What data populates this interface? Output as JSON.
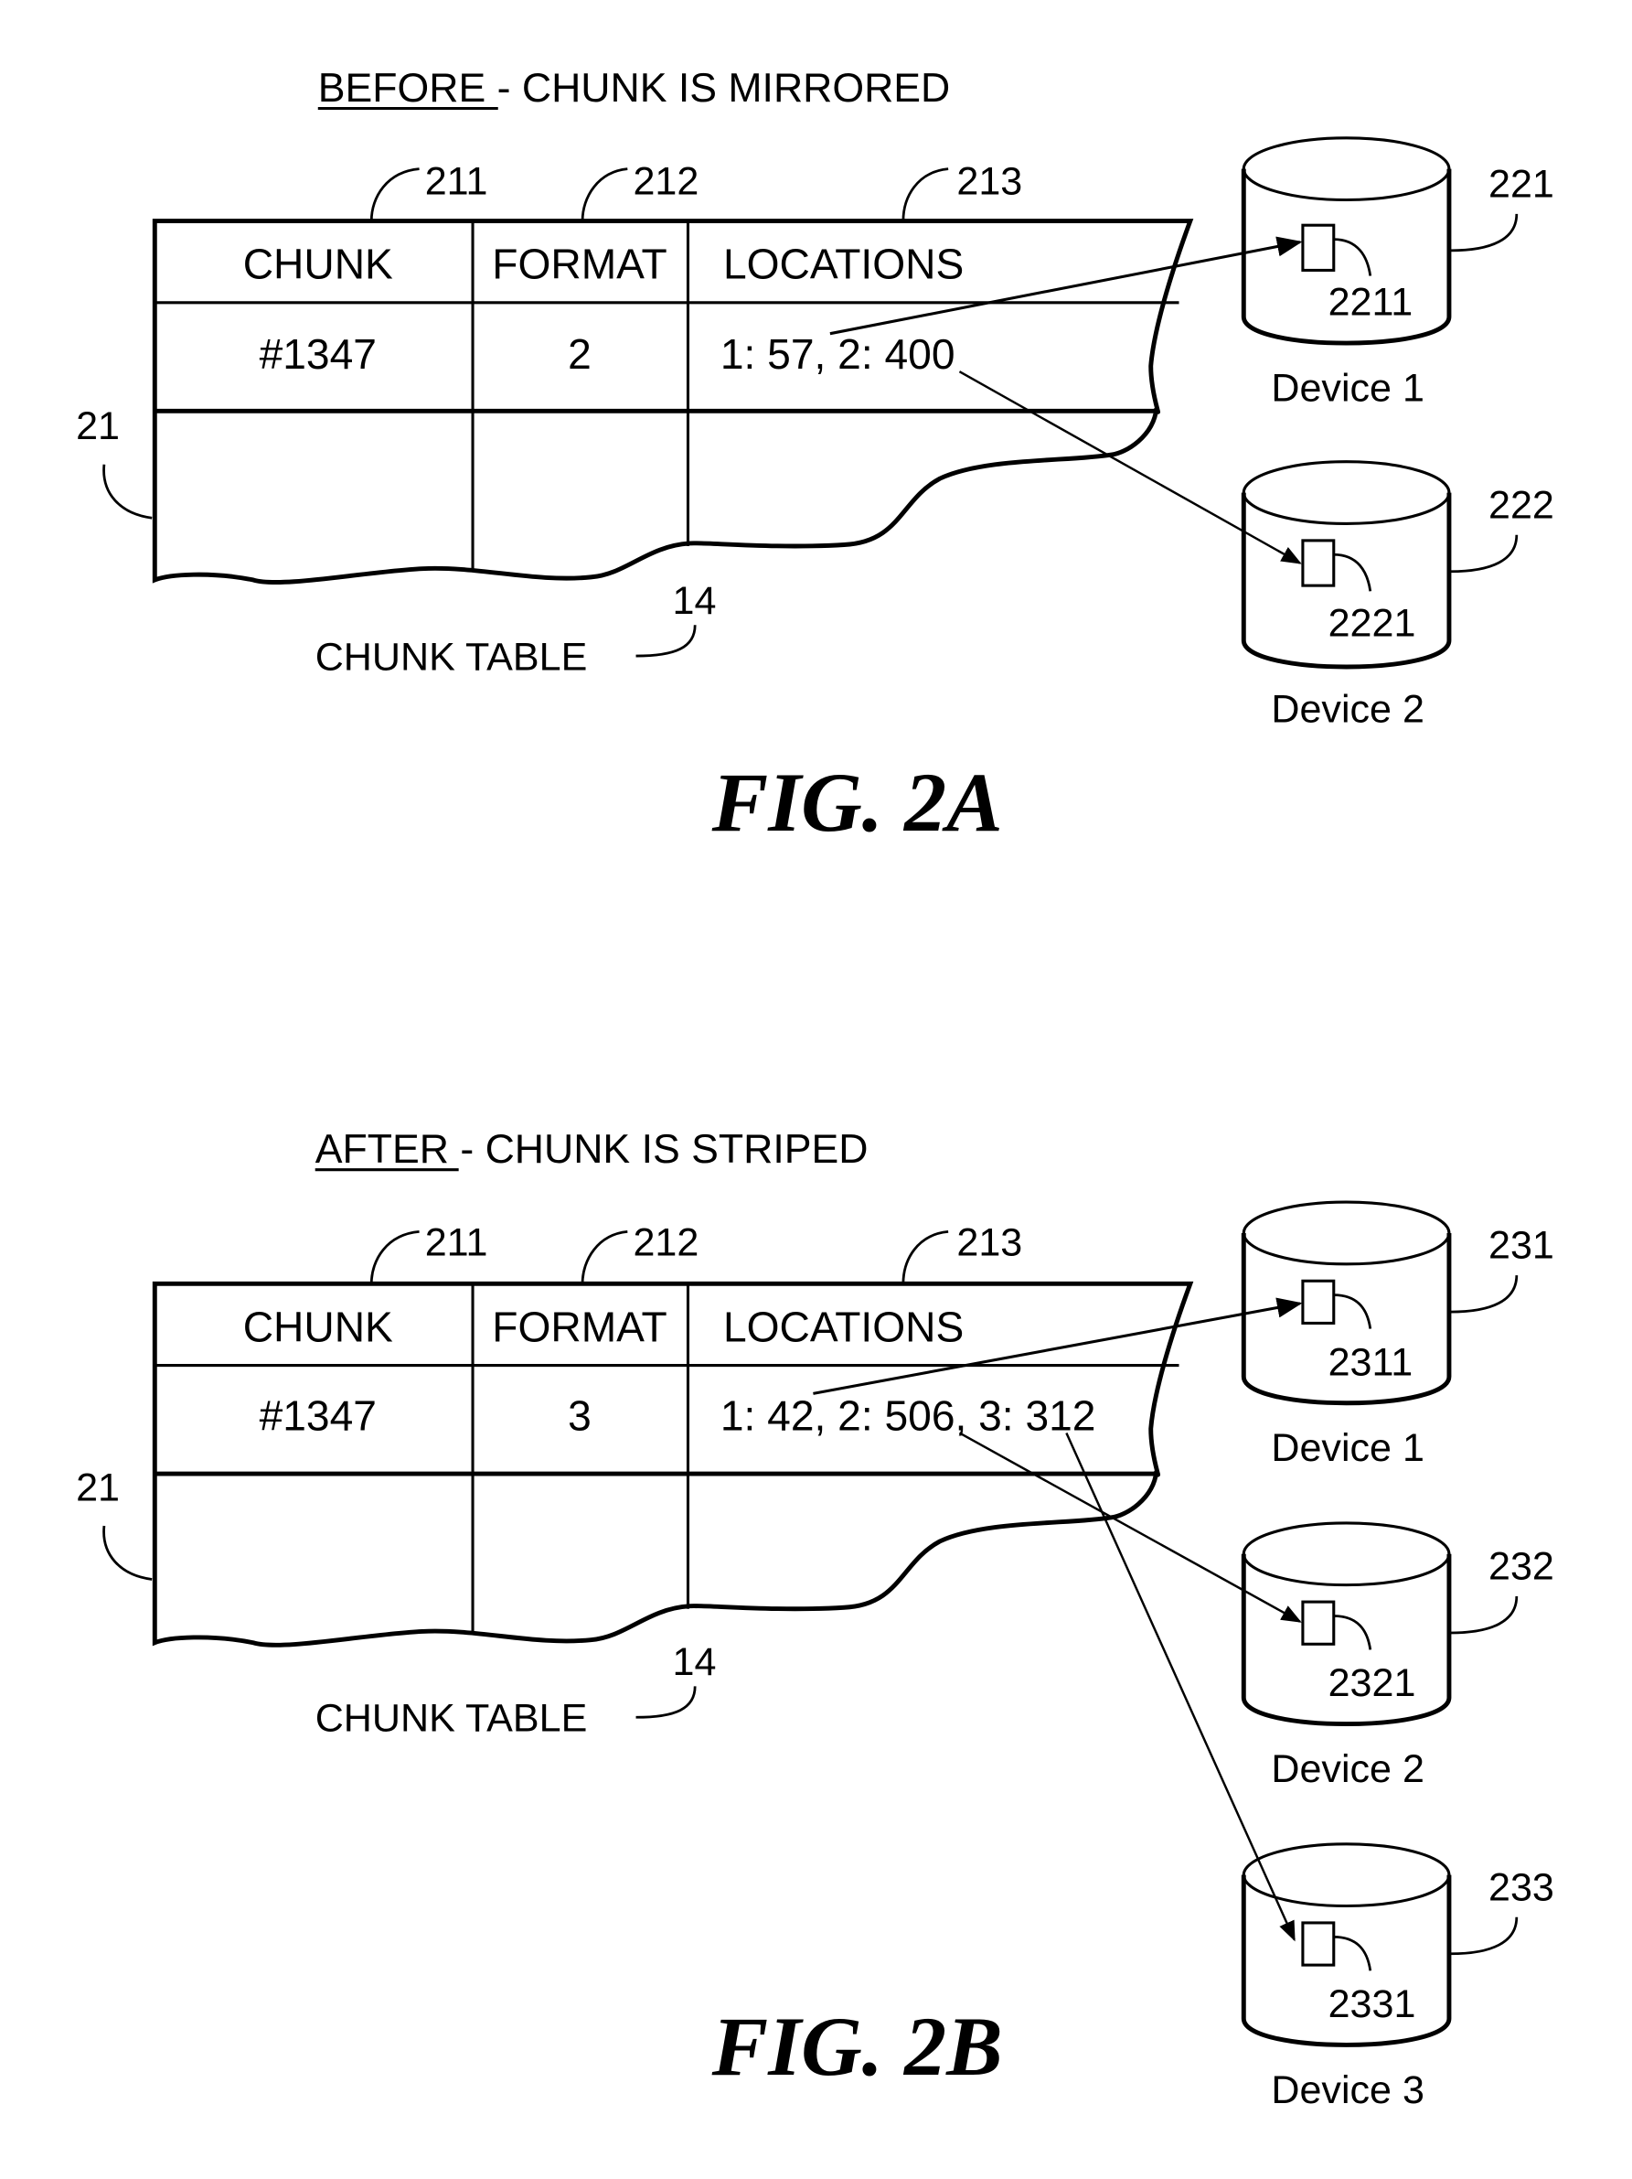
{
  "figures": [
    {
      "id": "2A",
      "caption": "FIG. 2A",
      "heading_emphasis": "BEFORE",
      "heading_rest": " - CHUNK IS MIRRORED",
      "table_label": "CHUNK TABLE",
      "table_ref": "14",
      "table_row_ref": "21",
      "columns": [
        {
          "label": "CHUNK",
          "ref": "211"
        },
        {
          "label": "FORMAT",
          "ref": "212"
        },
        {
          "label": "LOCATIONS",
          "ref": "213"
        }
      ],
      "row": {
        "chunk": "#1347",
        "format": "2",
        "locations": "1: 57, 2: 400"
      },
      "devices": [
        {
          "name": "Device 1",
          "ref": "221",
          "block_ref": "2211"
        },
        {
          "name": "Device 2",
          "ref": "222",
          "block_ref": "2221"
        }
      ]
    },
    {
      "id": "2B",
      "caption": "FIG. 2B",
      "heading_emphasis": "AFTER",
      "heading_rest": " - CHUNK IS STRIPED",
      "table_label": "CHUNK TABLE",
      "table_ref": "14",
      "table_row_ref": "21",
      "columns": [
        {
          "label": "CHUNK",
          "ref": "211"
        },
        {
          "label": "FORMAT",
          "ref": "212"
        },
        {
          "label": "LOCATIONS",
          "ref": "213"
        }
      ],
      "row": {
        "chunk": "#1347",
        "format": "3",
        "locations": "1: 42, 2: 506, 3: 312"
      },
      "devices": [
        {
          "name": "Device 1",
          "ref": "231",
          "block_ref": "2311"
        },
        {
          "name": "Device 2",
          "ref": "232",
          "block_ref": "2321"
        },
        {
          "name": "Device 3",
          "ref": "233",
          "block_ref": "2331"
        }
      ]
    }
  ]
}
